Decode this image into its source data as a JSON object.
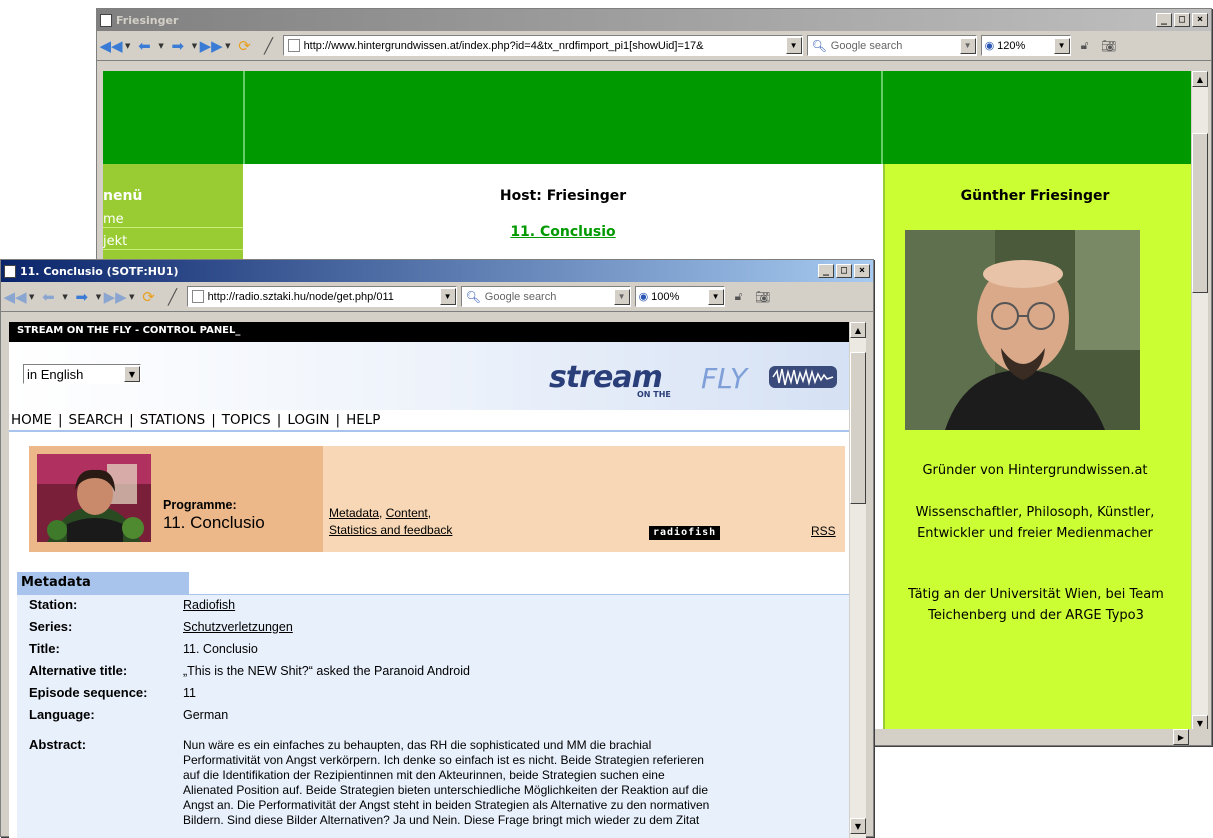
{
  "back_window": {
    "title": "Friesinger",
    "url": "http://www.hintergrundwissen.at/index.php?id=4&tx_nrdfimport_pi1[showUid]=17&",
    "search_placeholder": "Google search",
    "zoom": "120%",
    "menu_heading": "nenü",
    "menu_items": [
      "me",
      "jekt"
    ],
    "host_label": "Host: Friesinger",
    "episode_link": "11. Conclusio",
    "person_name": "Günther Friesinger",
    "bio_1": "Gründer von Hintergrundwissen.at",
    "bio_2": "Wissenschaftler, Philosoph, Künstler, Entwickler und freier Medienmacher",
    "bio_3": "Tätig an der Universität Wien, bei Team Teichenberg und der ARGE Typo3",
    "colors": {
      "header_green": "#009900",
      "menu_green": "#99cc33",
      "side_lime": "#ccff33",
      "link_green": "#009900"
    }
  },
  "front_window": {
    "title": "11. Conclusio (SOTF:HU1)",
    "url": "http://radio.sztaki.hu/node/get.php/011",
    "search_placeholder": "Google search",
    "zoom": "100%",
    "page_header": "STREAM ON THE FLY - CONTROL PANEL_",
    "logo_text": "stream",
    "logo_sub": "ON THE",
    "logo_fly": "FLY",
    "language_select": "in English",
    "nav": [
      "HOME",
      "SEARCH",
      "STATIONS",
      "TOPICS",
      "LOGIN",
      "HELP"
    ],
    "programme_label": "Programme:",
    "programme_name": "11. Conclusio",
    "links": [
      "Metadata",
      "Content",
      "Statistics and feedback"
    ],
    "station_logo": "radiofish",
    "rss": "RSS",
    "metadata_tab": "Metadata",
    "metadata": [
      {
        "label": "Station:",
        "value": "Radiofish",
        "link": true
      },
      {
        "label": "Series:",
        "value": "Schutzverletzungen",
        "link": true
      },
      {
        "label": "Title:",
        "value": "11. Conclusio",
        "link": false
      },
      {
        "label": "Alternative title:",
        "value": "„This is the NEW Shit?“ asked the Paranoid Android",
        "link": false
      },
      {
        "label": "Episode sequence:",
        "value": "11",
        "link": false
      },
      {
        "label": "Language:",
        "value": "German",
        "link": false
      }
    ],
    "abstract_label": "Abstract:",
    "abstract_lines": [
      "Nun wäre es ein einfaches zu behaupten, das RH die sophisticated und MM die brachial",
      "Performativität von Angst verkörpern. Ich denke so einfach ist es nicht. Beide Strategien referieren",
      "auf die Identifikation der Rezipientinnen mit den Akteurinnen, beide Strategien suchen eine",
      "Alienated Position auf. Beide Strategien bieten unterschiedliche Möglichkeiten der Reaktion auf die",
      "Angst an. Die Performativität der Angst steht in beiden Strategien als Alternative zu den normativen",
      "Bildern. Sind diese Bilder Alternativen? Ja und Nein. Diese Frage bringt mich wieder zu dem Zitat"
    ],
    "colors": {
      "header_black": "#000000",
      "programme_bg": "#f5c9a0",
      "metadata_bg": "#e8f0fb",
      "tab_blue": "#a9c4ec"
    }
  }
}
